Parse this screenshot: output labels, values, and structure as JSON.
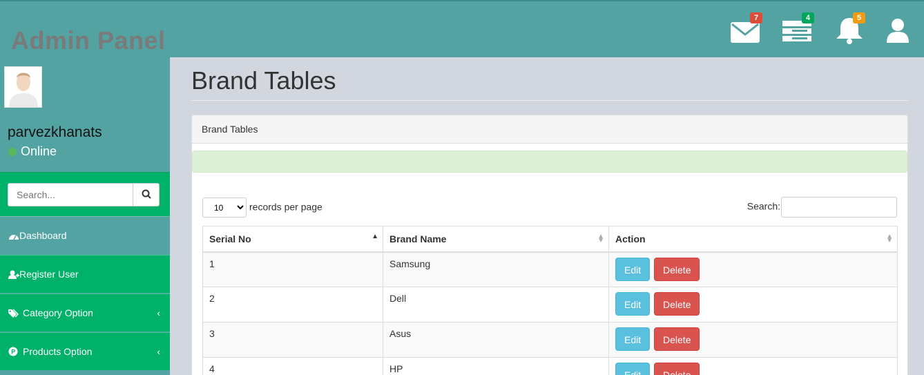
{
  "header": {
    "brand": "Admin Panel",
    "messages_badge": "7",
    "tasks_badge": "4",
    "notifications_badge": "5"
  },
  "sidebar": {
    "username": "parvezkhanats",
    "status": "Online",
    "search_placeholder": "Search...",
    "items": [
      {
        "label": "Dashboard",
        "icon": "dashboard-icon"
      },
      {
        "label": "Register User",
        "icon": "user-plus-icon"
      },
      {
        "label": "Category Option",
        "icon": "tags-icon"
      },
      {
        "label": "Products Option",
        "icon": "product-icon"
      }
    ]
  },
  "main": {
    "page_title": "Brand Tables",
    "panel_heading": "Brand Tables",
    "length_value": "10",
    "length_label": "records per page",
    "search_label": "Search:",
    "columns": [
      "Serial No",
      "Brand Name",
      "Action"
    ],
    "rows": [
      {
        "serial": "1",
        "brand": "Samsung"
      },
      {
        "serial": "2",
        "brand": "Dell"
      },
      {
        "serial": "3",
        "brand": "Asus"
      },
      {
        "serial": "4",
        "brand": "HP"
      }
    ],
    "edit_label": "Edit",
    "delete_label": "Delete"
  },
  "colors": {
    "header_bg": "#54a3a3",
    "sidebar_green": "#00b16a",
    "edit_button": "#5bc0de",
    "delete_button": "#d9534f"
  }
}
